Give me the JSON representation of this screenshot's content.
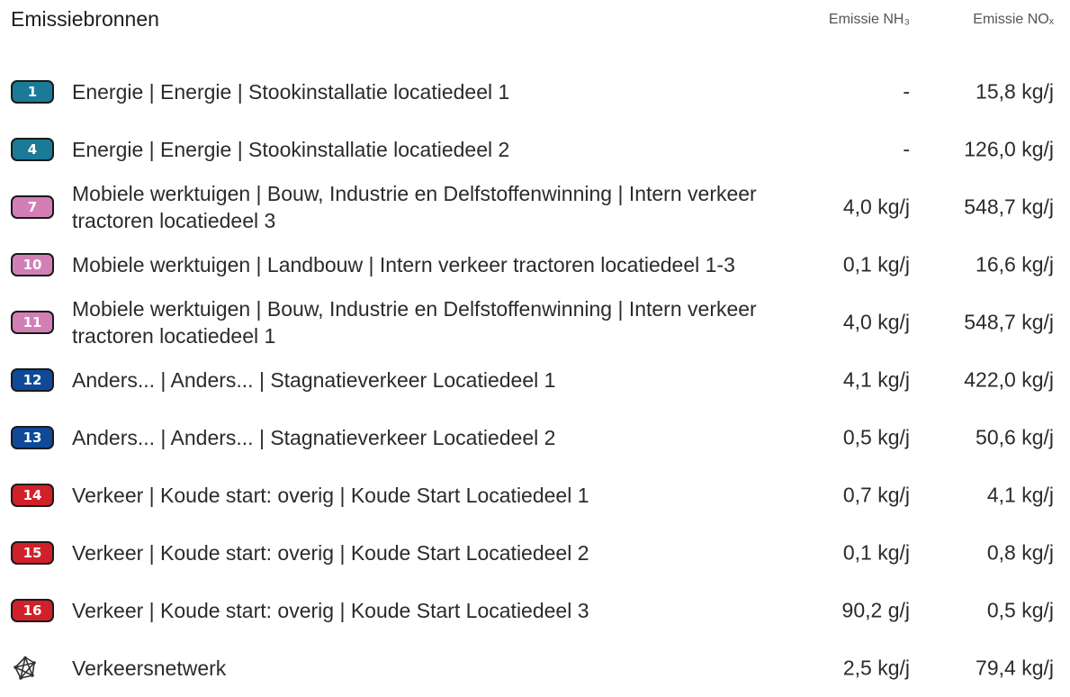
{
  "header": {
    "title": "Emissiebronnen",
    "col_nh3": "Emissie NH₃",
    "col_nox": "Emissie NOₓ"
  },
  "colors": {
    "teal": "#1a7a98",
    "pink": "#d27fb6",
    "navy": "#0e4a98",
    "red": "#d1202a"
  },
  "rows": [
    {
      "badge": "1",
      "badge_color": "#1a7a98",
      "label": "Energie | Energie | Stookinstallatie locatiedeel 1",
      "nh3": "-",
      "nox": "15,8 kg/j"
    },
    {
      "badge": "4",
      "badge_color": "#1a7a98",
      "label": "Energie | Energie | Stookinstallatie locatiedeel 2",
      "nh3": "-",
      "nox": "126,0 kg/j"
    },
    {
      "badge": "7",
      "badge_color": "#d27fb6",
      "label": "Mobiele werktuigen | Bouw, Industrie en Delfstoffenwinning | Intern verkeer tractoren locatiedeel 3",
      "nh3": "4,0 kg/j",
      "nox": "548,7 kg/j"
    },
    {
      "badge": "10",
      "badge_color": "#d27fb6",
      "label": "Mobiele werktuigen | Landbouw | Intern verkeer tractoren locatiedeel 1-3",
      "nh3": "0,1 kg/j",
      "nox": "16,6 kg/j"
    },
    {
      "badge": "11",
      "badge_color": "#d27fb6",
      "label": "Mobiele werktuigen | Bouw, Industrie en Delfstoffenwinning | Intern verkeer tractoren locatiedeel 1",
      "nh3": "4,0 kg/j",
      "nox": "548,7 kg/j"
    },
    {
      "badge": "12",
      "badge_color": "#0e4a98",
      "label": "Anders... | Anders... | Stagnatieverkeer Locatiedeel 1",
      "nh3": "4,1 kg/j",
      "nox": "422,0 kg/j"
    },
    {
      "badge": "13",
      "badge_color": "#0e4a98",
      "label": "Anders... | Anders... | Stagnatieverkeer Locatiedeel 2",
      "nh3": "0,5 kg/j",
      "nox": "50,6 kg/j"
    },
    {
      "badge": "14",
      "badge_color": "#d1202a",
      "label": "Verkeer | Koude start: overig | Koude Start Locatiedeel 1",
      "nh3": "0,7 kg/j",
      "nox": "4,1 kg/j"
    },
    {
      "badge": "15",
      "badge_color": "#d1202a",
      "label": "Verkeer | Koude start: overig | Koude Start Locatiedeel 2",
      "nh3": "0,1 kg/j",
      "nox": "0,8 kg/j"
    },
    {
      "badge": "16",
      "badge_color": "#d1202a",
      "label": "Verkeer | Koude start: overig | Koude Start Locatiedeel 3",
      "nh3": "90,2 g/j",
      "nox": "0,5 kg/j"
    }
  ],
  "network_row": {
    "icon": "network-icon",
    "label": "Verkeersnetwerk",
    "nh3": "2,5 kg/j",
    "nox": "79,4 kg/j"
  }
}
